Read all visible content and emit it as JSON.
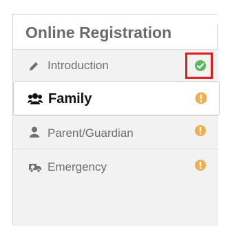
{
  "panel": {
    "title": "Online Registration"
  },
  "nav": {
    "items": [
      {
        "label": "Introduction",
        "icon": "pencil-icon",
        "status": "complete",
        "status_icon": "check-circle-icon"
      },
      {
        "label": "Family",
        "icon": "users-icon",
        "status": "incomplete",
        "status_icon": "exclamation-circle-icon",
        "active": true
      },
      {
        "label": "Parent/Guardian",
        "icon": "user-icon",
        "status": "incomplete",
        "status_icon": "exclamation-circle-icon"
      },
      {
        "label": "Emergency",
        "icon": "ambulance-icon",
        "status": "incomplete",
        "status_icon": "exclamation-circle-icon"
      }
    ]
  },
  "colors": {
    "complete": "#5cb85c",
    "incomplete": "#f0ad4e",
    "highlight": "#e21b1b"
  }
}
